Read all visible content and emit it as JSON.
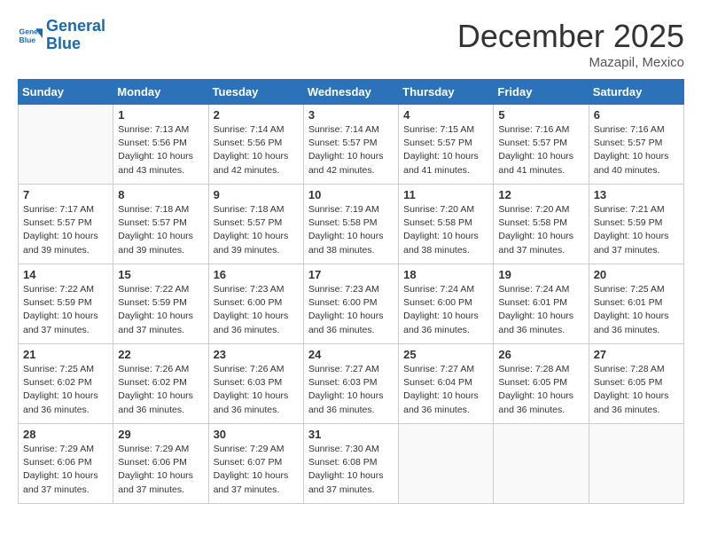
{
  "header": {
    "logo_line1": "General",
    "logo_line2": "Blue",
    "month_year": "December 2025",
    "location": "Mazapil, Mexico"
  },
  "weekdays": [
    "Sunday",
    "Monday",
    "Tuesday",
    "Wednesday",
    "Thursday",
    "Friday",
    "Saturday"
  ],
  "weeks": [
    [
      {
        "day": "",
        "info": ""
      },
      {
        "day": "1",
        "info": "Sunrise: 7:13 AM\nSunset: 5:56 PM\nDaylight: 10 hours\nand 43 minutes."
      },
      {
        "day": "2",
        "info": "Sunrise: 7:14 AM\nSunset: 5:56 PM\nDaylight: 10 hours\nand 42 minutes."
      },
      {
        "day": "3",
        "info": "Sunrise: 7:14 AM\nSunset: 5:57 PM\nDaylight: 10 hours\nand 42 minutes."
      },
      {
        "day": "4",
        "info": "Sunrise: 7:15 AM\nSunset: 5:57 PM\nDaylight: 10 hours\nand 41 minutes."
      },
      {
        "day": "5",
        "info": "Sunrise: 7:16 AM\nSunset: 5:57 PM\nDaylight: 10 hours\nand 41 minutes."
      },
      {
        "day": "6",
        "info": "Sunrise: 7:16 AM\nSunset: 5:57 PM\nDaylight: 10 hours\nand 40 minutes."
      }
    ],
    [
      {
        "day": "7",
        "info": "Sunrise: 7:17 AM\nSunset: 5:57 PM\nDaylight: 10 hours\nand 39 minutes."
      },
      {
        "day": "8",
        "info": "Sunrise: 7:18 AM\nSunset: 5:57 PM\nDaylight: 10 hours\nand 39 minutes."
      },
      {
        "day": "9",
        "info": "Sunrise: 7:18 AM\nSunset: 5:57 PM\nDaylight: 10 hours\nand 39 minutes."
      },
      {
        "day": "10",
        "info": "Sunrise: 7:19 AM\nSunset: 5:58 PM\nDaylight: 10 hours\nand 38 minutes."
      },
      {
        "day": "11",
        "info": "Sunrise: 7:20 AM\nSunset: 5:58 PM\nDaylight: 10 hours\nand 38 minutes."
      },
      {
        "day": "12",
        "info": "Sunrise: 7:20 AM\nSunset: 5:58 PM\nDaylight: 10 hours\nand 37 minutes."
      },
      {
        "day": "13",
        "info": "Sunrise: 7:21 AM\nSunset: 5:59 PM\nDaylight: 10 hours\nand 37 minutes."
      }
    ],
    [
      {
        "day": "14",
        "info": "Sunrise: 7:22 AM\nSunset: 5:59 PM\nDaylight: 10 hours\nand 37 minutes."
      },
      {
        "day": "15",
        "info": "Sunrise: 7:22 AM\nSunset: 5:59 PM\nDaylight: 10 hours\nand 37 minutes."
      },
      {
        "day": "16",
        "info": "Sunrise: 7:23 AM\nSunset: 6:00 PM\nDaylight: 10 hours\nand 36 minutes."
      },
      {
        "day": "17",
        "info": "Sunrise: 7:23 AM\nSunset: 6:00 PM\nDaylight: 10 hours\nand 36 minutes."
      },
      {
        "day": "18",
        "info": "Sunrise: 7:24 AM\nSunset: 6:00 PM\nDaylight: 10 hours\nand 36 minutes."
      },
      {
        "day": "19",
        "info": "Sunrise: 7:24 AM\nSunset: 6:01 PM\nDaylight: 10 hours\nand 36 minutes."
      },
      {
        "day": "20",
        "info": "Sunrise: 7:25 AM\nSunset: 6:01 PM\nDaylight: 10 hours\nand 36 minutes."
      }
    ],
    [
      {
        "day": "21",
        "info": "Sunrise: 7:25 AM\nSunset: 6:02 PM\nDaylight: 10 hours\nand 36 minutes."
      },
      {
        "day": "22",
        "info": "Sunrise: 7:26 AM\nSunset: 6:02 PM\nDaylight: 10 hours\nand 36 minutes."
      },
      {
        "day": "23",
        "info": "Sunrise: 7:26 AM\nSunset: 6:03 PM\nDaylight: 10 hours\nand 36 minutes."
      },
      {
        "day": "24",
        "info": "Sunrise: 7:27 AM\nSunset: 6:03 PM\nDaylight: 10 hours\nand 36 minutes."
      },
      {
        "day": "25",
        "info": "Sunrise: 7:27 AM\nSunset: 6:04 PM\nDaylight: 10 hours\nand 36 minutes."
      },
      {
        "day": "26",
        "info": "Sunrise: 7:28 AM\nSunset: 6:05 PM\nDaylight: 10 hours\nand 36 minutes."
      },
      {
        "day": "27",
        "info": "Sunrise: 7:28 AM\nSunset: 6:05 PM\nDaylight: 10 hours\nand 36 minutes."
      }
    ],
    [
      {
        "day": "28",
        "info": "Sunrise: 7:29 AM\nSunset: 6:06 PM\nDaylight: 10 hours\nand 37 minutes."
      },
      {
        "day": "29",
        "info": "Sunrise: 7:29 AM\nSunset: 6:06 PM\nDaylight: 10 hours\nand 37 minutes."
      },
      {
        "day": "30",
        "info": "Sunrise: 7:29 AM\nSunset: 6:07 PM\nDaylight: 10 hours\nand 37 minutes."
      },
      {
        "day": "31",
        "info": "Sunrise: 7:30 AM\nSunset: 6:08 PM\nDaylight: 10 hours\nand 37 minutes."
      },
      {
        "day": "",
        "info": ""
      },
      {
        "day": "",
        "info": ""
      },
      {
        "day": "",
        "info": ""
      }
    ]
  ]
}
